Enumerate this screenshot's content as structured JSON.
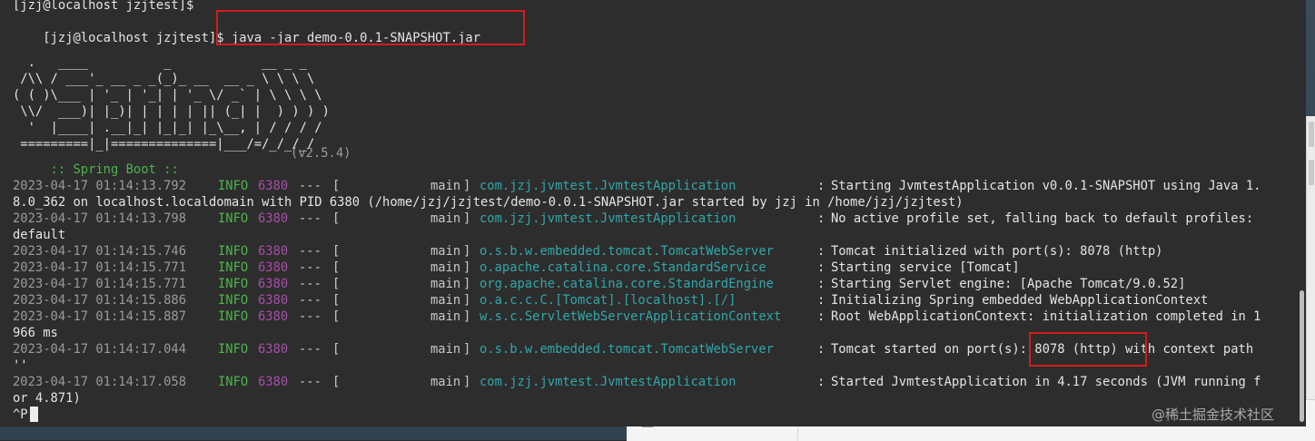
{
  "prompt_lines": [
    "[jzj@localhost jzjtest]$",
    "[jzj@localhost jzjtest]$ "
  ],
  "command": "java -jar demo-0.0.1-SNAPSHOT.jar",
  "banner": {
    "art": [
      "  .   ____          _            __ _ _",
      " /\\\\ / ___'_ __ _ _(_)_ __  __ _ \\ \\ \\ \\",
      "( ( )\\___ | '_ | '_| | '_ \\/ _` | \\ \\ \\ \\",
      " \\\\/  ___)| |_)| | | | | || (_| |  ) ) ) )",
      "  '  |____| .__|_| |_|_| |_\\__, | / / / /",
      " =========|_|==============|___/=/_/_/_/"
    ],
    "boot_label": " :: Spring Boot :: ",
    "boot_version": "(v2.5.4)"
  },
  "logs": [
    {
      "ts": "2023-04-17 01:14:13.792",
      "level": "INFO",
      "pid": "6380",
      "sep": "---",
      "thread": "main",
      "logger": "com.jzj.jvmtest.JvmtestApplication",
      "msg": "Starting JvmtestApplication v0.0.1-SNAPSHOT using Java 1.",
      "cont": "8.0_362 on localhost.localdomain with PID 6380 (/home/jzj/jzjtest/demo-0.0.1-SNAPSHOT.jar started by jzj in /home/jzj/jzjtest)"
    },
    {
      "ts": "2023-04-17 01:14:13.798",
      "level": "INFO",
      "pid": "6380",
      "sep": "---",
      "thread": "main",
      "logger": "com.jzj.jvmtest.JvmtestApplication",
      "msg": "No active profile set, falling back to default profiles:",
      "cont": "default"
    },
    {
      "ts": "2023-04-17 01:14:15.746",
      "level": "INFO",
      "pid": "6380",
      "sep": "---",
      "thread": "main",
      "logger": "o.s.b.w.embedded.tomcat.TomcatWebServer",
      "msg": "Tomcat initialized with port(s): 8078 (http)",
      "cont": ""
    },
    {
      "ts": "2023-04-17 01:14:15.771",
      "level": "INFO",
      "pid": "6380",
      "sep": "---",
      "thread": "main",
      "logger": "o.apache.catalina.core.StandardService",
      "msg": "Starting service [Tomcat]",
      "cont": ""
    },
    {
      "ts": "2023-04-17 01:14:15.771",
      "level": "INFO",
      "pid": "6380",
      "sep": "---",
      "thread": "main",
      "logger": "org.apache.catalina.core.StandardEngine",
      "msg": "Starting Servlet engine: [Apache Tomcat/9.0.52]",
      "cont": ""
    },
    {
      "ts": "2023-04-17 01:14:15.886",
      "level": "INFO",
      "pid": "6380",
      "sep": "---",
      "thread": "main",
      "logger": "o.a.c.c.C.[Tomcat].[localhost].[/]",
      "msg": "Initializing Spring embedded WebApplicationContext",
      "cont": ""
    },
    {
      "ts": "2023-04-17 01:14:15.887",
      "level": "INFO",
      "pid": "6380",
      "sep": "---",
      "thread": "main",
      "logger": "w.s.c.ServletWebServerApplicationContext",
      "msg": "Root WebApplicationContext: initialization completed in 1",
      "cont": "966 ms"
    },
    {
      "ts": "2023-04-17 01:14:17.044",
      "level": "INFO",
      "pid": "6380",
      "sep": "---",
      "thread": "main",
      "logger": "o.s.b.w.embedded.tomcat.TomcatWebServer",
      "msg": "Tomcat started on port(s): 8078 (http) with context path",
      "cont": "''"
    },
    {
      "ts": "2023-04-17 01:14:17.058",
      "level": "INFO",
      "pid": "6380",
      "sep": "---",
      "thread": "main",
      "logger": "com.jzj.jvmtest.JvmtestApplication",
      "msg": "Started JvmtestApplication in 4.17 seconds (JVM running f",
      "cont": "or 4.871)"
    }
  ],
  "last_input": "^P",
  "watermark": "@稀土掘金技术社区",
  "colors": {
    "terminal_bg": "#2d2d2d",
    "text": "#e4e4e4",
    "info": "#4fb34f",
    "pid": "#a54fa5",
    "logger": "#32a6a8",
    "highlight_box": "#d21c1c"
  }
}
